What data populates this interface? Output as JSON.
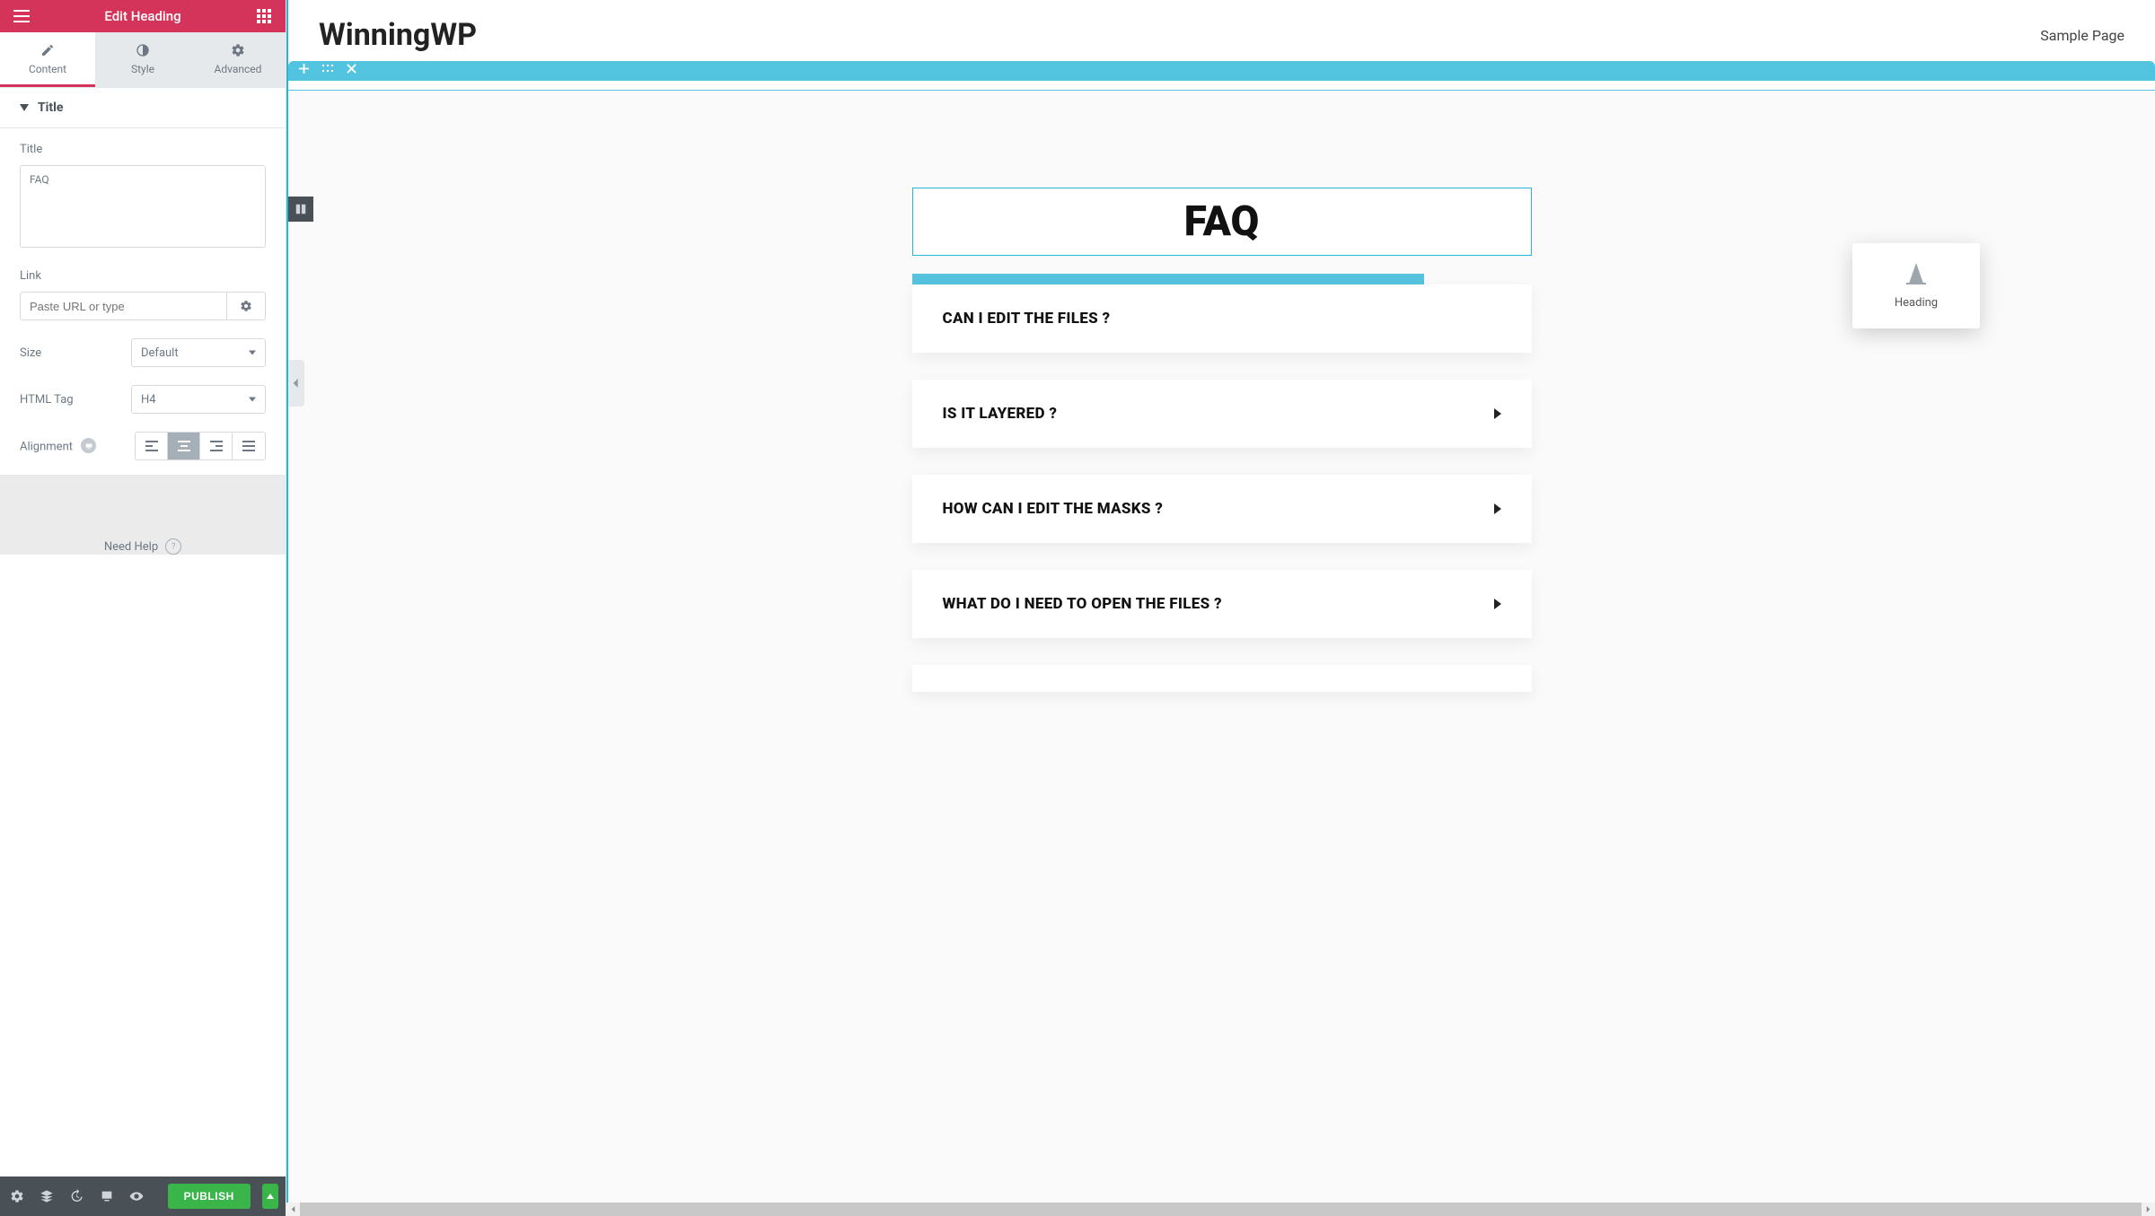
{
  "sidebar": {
    "header_title": "Edit Heading",
    "tabs": {
      "content": "Content",
      "style": "Style",
      "advanced": "Advanced"
    },
    "section": "Title",
    "fields": {
      "title_label": "Title",
      "title_value": "FAQ",
      "link_label": "Link",
      "link_placeholder": "Paste URL or type",
      "link_value": "",
      "size_label": "Size",
      "size_value": "Default",
      "tag_label": "HTML Tag",
      "tag_value": "H4",
      "alignment_label": "Alignment"
    },
    "help": "Need Help",
    "publish": "PUBLISH"
  },
  "canvas": {
    "site_title": "WinningWP",
    "nav_link": "Sample Page",
    "heading_text": "FAQ",
    "drag_widget": "Heading",
    "accordion": [
      "CAN I EDIT THE FILES ?",
      "IS IT LAYERED ?",
      "HOW CAN I EDIT THE MASKS ?",
      "WHAT DO I NEED TO OPEN THE FILES ?"
    ]
  }
}
